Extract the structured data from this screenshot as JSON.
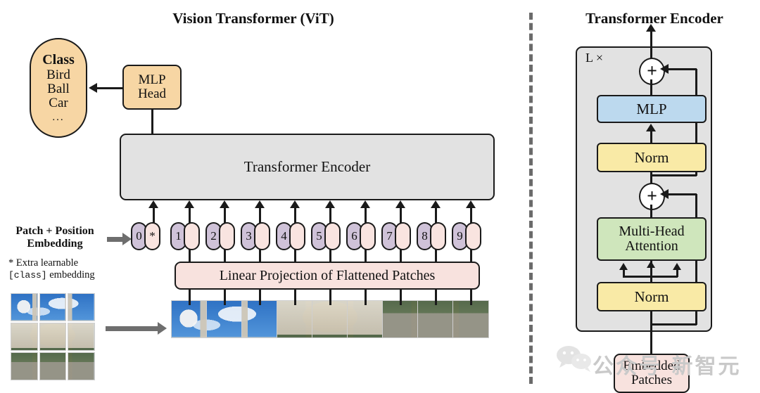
{
  "left_panel": {
    "title": "Vision Transformer (ViT)",
    "class_box": {
      "header": "Class",
      "items": [
        "Bird",
        "Ball",
        "Car"
      ],
      "ellipsis": "..."
    },
    "mlp_head": {
      "line1": "MLP",
      "line2": "Head"
    },
    "encoder_bar": "Transformer Encoder",
    "linear_projection": "Linear Projection of Flattened Patches",
    "embedding_label": {
      "line1": "Patch + Position",
      "line2": "Embedding"
    },
    "footnote": {
      "star": "*",
      "line1": "Extra learnable",
      "code": "[class]",
      "line1b": "embedding"
    },
    "tokens": [
      {
        "pos": "0",
        "patch": "*",
        "is_class": true
      },
      {
        "pos": "1",
        "patch": "",
        "is_class": false
      },
      {
        "pos": "2",
        "patch": "",
        "is_class": false
      },
      {
        "pos": "3",
        "patch": "",
        "is_class": false
      },
      {
        "pos": "4",
        "patch": "",
        "is_class": false
      },
      {
        "pos": "5",
        "patch": "",
        "is_class": false
      },
      {
        "pos": "6",
        "patch": "",
        "is_class": false
      },
      {
        "pos": "7",
        "patch": "",
        "is_class": false
      },
      {
        "pos": "8",
        "patch": "",
        "is_class": false
      },
      {
        "pos": "9",
        "patch": "",
        "is_class": false
      }
    ],
    "patch_count": 9,
    "source_grid_cells": 9
  },
  "right_panel": {
    "title": "Transformer Encoder",
    "repeat_label": "L ×",
    "blocks": {
      "mlp": "MLP",
      "norm_top": "Norm",
      "attention": {
        "line1": "Multi-Head",
        "line2": "Attention"
      },
      "norm_bottom": "Norm",
      "embedded_patches": {
        "line1": "Embedded",
        "line2": "Patches"
      }
    },
    "add_symbol": "+",
    "attention_input_arrows": 3
  },
  "watermark": {
    "text": "公众号     新智元"
  },
  "colors": {
    "class_box": "#f7d6a4",
    "mlp_head": "#f7d6a4",
    "encoder_bar": "#e2e2e2",
    "linear_projection": "#f8e2de",
    "position_token": "#cfc2d8",
    "patch_token": "#f9e4e0",
    "mlp": "#bcd9ee",
    "norm": "#f9eaa6",
    "attention": "#cfe6bc",
    "embedded_patches": "#f8e2de",
    "encoder_outer": "#e2e2e2",
    "stroke": "#1a1a1a",
    "divider": "#6b6b6b"
  }
}
